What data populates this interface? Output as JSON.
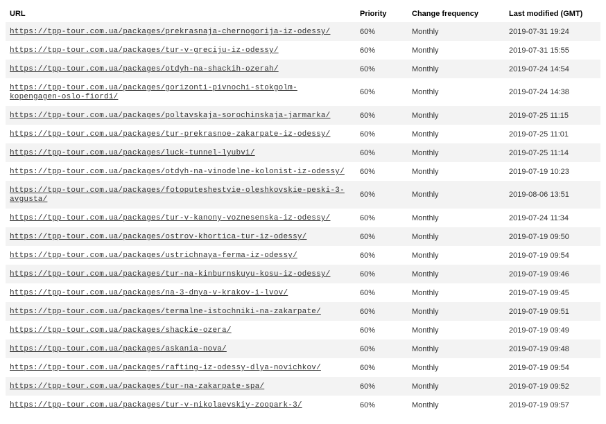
{
  "table": {
    "headers": {
      "url": "URL",
      "priority": "Priority",
      "changefreq": "Change frequency",
      "lastmod": "Last modified (GMT)"
    },
    "rows": [
      {
        "url": "https://tpp-tour.com.ua/packages/prekrasnaja-chernogorija-iz-odessy/",
        "priority": "60%",
        "changefreq": "Monthly",
        "lastmod": "2019-07-31 19:24"
      },
      {
        "url": "https://tpp-tour.com.ua/packages/tur-v-greciju-iz-odessy/",
        "priority": "60%",
        "changefreq": "Monthly",
        "lastmod": "2019-07-31 15:55"
      },
      {
        "url": "https://tpp-tour.com.ua/packages/otdyh-na-shackih-ozerah/",
        "priority": "60%",
        "changefreq": "Monthly",
        "lastmod": "2019-07-24 14:54"
      },
      {
        "url": "https://tpp-tour.com.ua/packages/gorizonti-pivnochi-stokgolm-kopengagen-oslo-fiordi/",
        "priority": "60%",
        "changefreq": "Monthly",
        "lastmod": "2019-07-24 14:38"
      },
      {
        "url": "https://tpp-tour.com.ua/packages/poltavskaja-sorochinskaja-jarmarka/",
        "priority": "60%",
        "changefreq": "Monthly",
        "lastmod": "2019-07-25 11:15"
      },
      {
        "url": "https://tpp-tour.com.ua/packages/tur-prekrasnoe-zakarpate-iz-odessy/",
        "priority": "60%",
        "changefreq": "Monthly",
        "lastmod": "2019-07-25 11:01"
      },
      {
        "url": "https://tpp-tour.com.ua/packages/luck-tunnel-lyubvi/",
        "priority": "60%",
        "changefreq": "Monthly",
        "lastmod": "2019-07-25 11:14"
      },
      {
        "url": "https://tpp-tour.com.ua/packages/otdyh-na-vinodelne-kolonist-iz-odessy/",
        "priority": "60%",
        "changefreq": "Monthly",
        "lastmod": "2019-07-19 10:23"
      },
      {
        "url": "https://tpp-tour.com.ua/packages/fotoputeshestvie-oleshkovskie-peski-3-avgusta/",
        "priority": "60%",
        "changefreq": "Monthly",
        "lastmod": "2019-08-06 13:51"
      },
      {
        "url": "https://tpp-tour.com.ua/packages/tur-v-kanony-voznesenska-iz-odessy/",
        "priority": "60%",
        "changefreq": "Monthly",
        "lastmod": "2019-07-24 11:34"
      },
      {
        "url": "https://tpp-tour.com.ua/packages/ostrov-khortica-tur-iz-odessy/",
        "priority": "60%",
        "changefreq": "Monthly",
        "lastmod": "2019-07-19 09:50"
      },
      {
        "url": "https://tpp-tour.com.ua/packages/ustrichnaya-ferma-iz-odessy/",
        "priority": "60%",
        "changefreq": "Monthly",
        "lastmod": "2019-07-19 09:54"
      },
      {
        "url": "https://tpp-tour.com.ua/packages/tur-na-kinburnskuyu-kosu-iz-odessy/",
        "priority": "60%",
        "changefreq": "Monthly",
        "lastmod": "2019-07-19 09:46"
      },
      {
        "url": "https://tpp-tour.com.ua/packages/na-3-dnya-v-krakov-i-lvov/",
        "priority": "60%",
        "changefreq": "Monthly",
        "lastmod": "2019-07-19 09:45"
      },
      {
        "url": "https://tpp-tour.com.ua/packages/termalne-istochniki-na-zakarpate/",
        "priority": "60%",
        "changefreq": "Monthly",
        "lastmod": "2019-07-19 09:51"
      },
      {
        "url": "https://tpp-tour.com.ua/packages/shackie-ozera/",
        "priority": "60%",
        "changefreq": "Monthly",
        "lastmod": "2019-07-19 09:49"
      },
      {
        "url": "https://tpp-tour.com.ua/packages/askania-nova/",
        "priority": "60%",
        "changefreq": "Monthly",
        "lastmod": "2019-07-19 09:48"
      },
      {
        "url": "https://tpp-tour.com.ua/packages/rafting-iz-odessy-dlya-novichkov/",
        "priority": "60%",
        "changefreq": "Monthly",
        "lastmod": "2019-07-19 09:54"
      },
      {
        "url": "https://tpp-tour.com.ua/packages/tur-na-zakarpate-spa/",
        "priority": "60%",
        "changefreq": "Monthly",
        "lastmod": "2019-07-19 09:52"
      },
      {
        "url": "https://tpp-tour.com.ua/packages/tur-v-nikolaevskiy-zoopark-3/",
        "priority": "60%",
        "changefreq": "Monthly",
        "lastmod": "2019-07-19 09:57"
      }
    ]
  }
}
